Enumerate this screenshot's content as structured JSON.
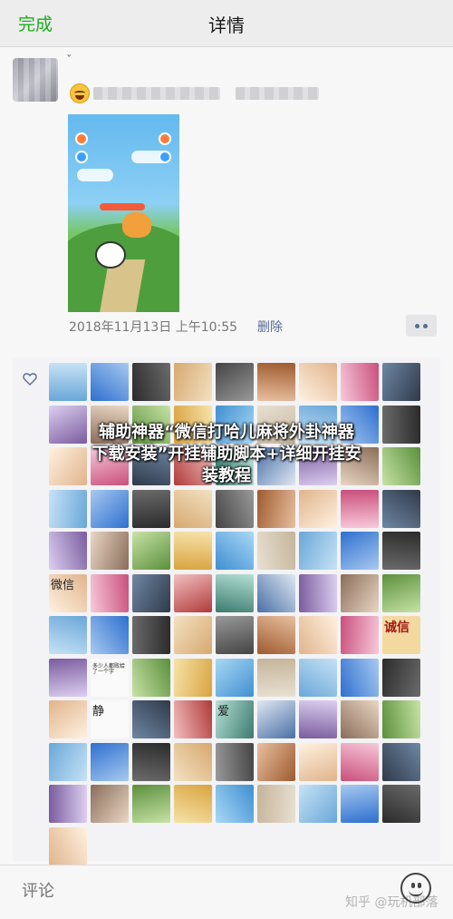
{
  "navbar": {
    "back_label": "完成",
    "title": "详情"
  },
  "post": {
    "timestamp": "2018年11月13日 上午10:55",
    "delete_label": "删除"
  },
  "overlay": {
    "line1": "辅助神器“微信打哈儿麻将外卦神器",
    "line2": "下载安装”开挂辅助脚本+详细开挂安",
    "line3": "装教程"
  },
  "likes": {
    "thumb_texts": [
      "诚信",
      "多少人都败给了一个字",
      "静",
      "爱",
      "微信"
    ]
  },
  "comment": {
    "placeholder": "评论"
  },
  "watermark": "知乎 @玩机部落",
  "colors": {
    "accent_green": "#1aad19",
    "link_blue": "#576b95"
  }
}
